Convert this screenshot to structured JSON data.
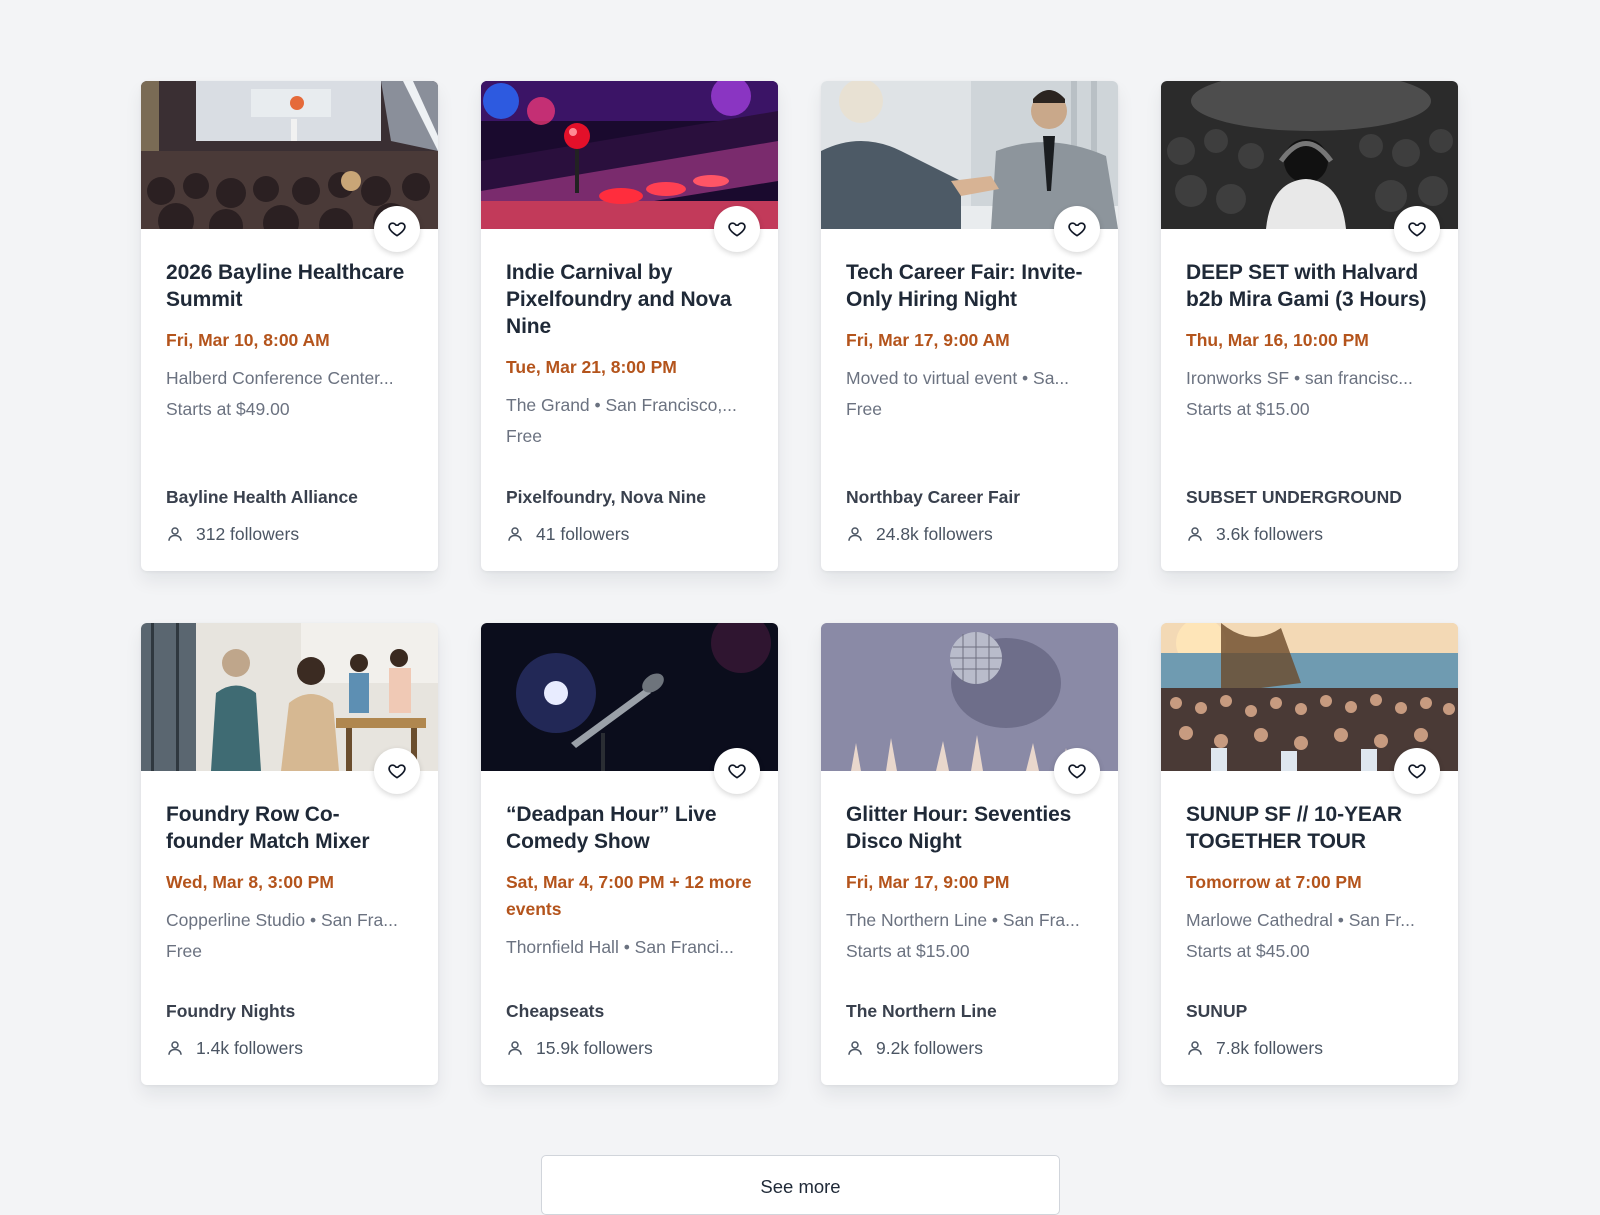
{
  "events": [
    {
      "title": "2026 Bayline Healthcare Summit",
      "date": "Fri, Mar 10, 8:00 AM",
      "venue": "Halberd Conference Center...",
      "price": "Starts at $49.00",
      "organizer": "Bayline Health Alliance",
      "followers": "312 followers"
    },
    {
      "title": "Indie Carnival by Pixelfoundry and Nova Nine",
      "date": "Tue, Mar 21, 8:00 PM",
      "venue": "The Grand • San Francisco,...",
      "price": "Free",
      "organizer": "Pixelfoundry, Nova Nine",
      "followers": "41 followers"
    },
    {
      "title": "Tech Career Fair: Invite-Only Hiring Night",
      "date": "Fri, Mar 17, 9:00 AM",
      "venue": "Moved to virtual event • Sa...",
      "price": "Free",
      "organizer": "Northbay Career Fair",
      "followers": "24.8k followers"
    },
    {
      "title": "DEEP SET with Halvard b2b Mira Gami (3 Hours)",
      "date": "Thu, Mar 16, 10:00 PM",
      "venue": "Ironworks SF • san francisc...",
      "price": "Starts at $15.00",
      "organizer": "SUBSET UNDERGROUND",
      "followers": "3.6k followers"
    },
    {
      "title": "Foundry Row Co-founder Match Mixer",
      "date": "Wed, Mar 8, 3:00 PM",
      "venue": "Copperline Studio • San Fra...",
      "price": "Free",
      "organizer": "Foundry Nights",
      "followers": "1.4k followers"
    },
    {
      "title": "“Deadpan Hour” Live Comedy Show",
      "date": "Sat, Mar 4, 7:00 PM + 12 more events",
      "venue": "Thornfield Hall • San Franci...",
      "price": "",
      "organizer": "Cheapseats",
      "followers": "15.9k followers"
    },
    {
      "title": "Glitter Hour: Seventies Disco Night",
      "date": "Fri, Mar 17, 9:00 PM",
      "venue": "The Northern Line • San Fra...",
      "price": "Starts at $15.00",
      "organizer": "The Northern Line",
      "followers": "9.2k followers"
    },
    {
      "title": "SUNUP SF // 10-YEAR TOGETHER TOUR",
      "date": "Tomorrow at 7:00 PM",
      "venue": "Marlowe Cathedral • San Fr...",
      "price": "Starts at $45.00",
      "organizer": "SUNUP",
      "followers": "7.8k followers"
    }
  ],
  "see_more_label": "See more",
  "colors": {
    "accent_date": "#b4541c",
    "background": "#f3f4f6"
  }
}
